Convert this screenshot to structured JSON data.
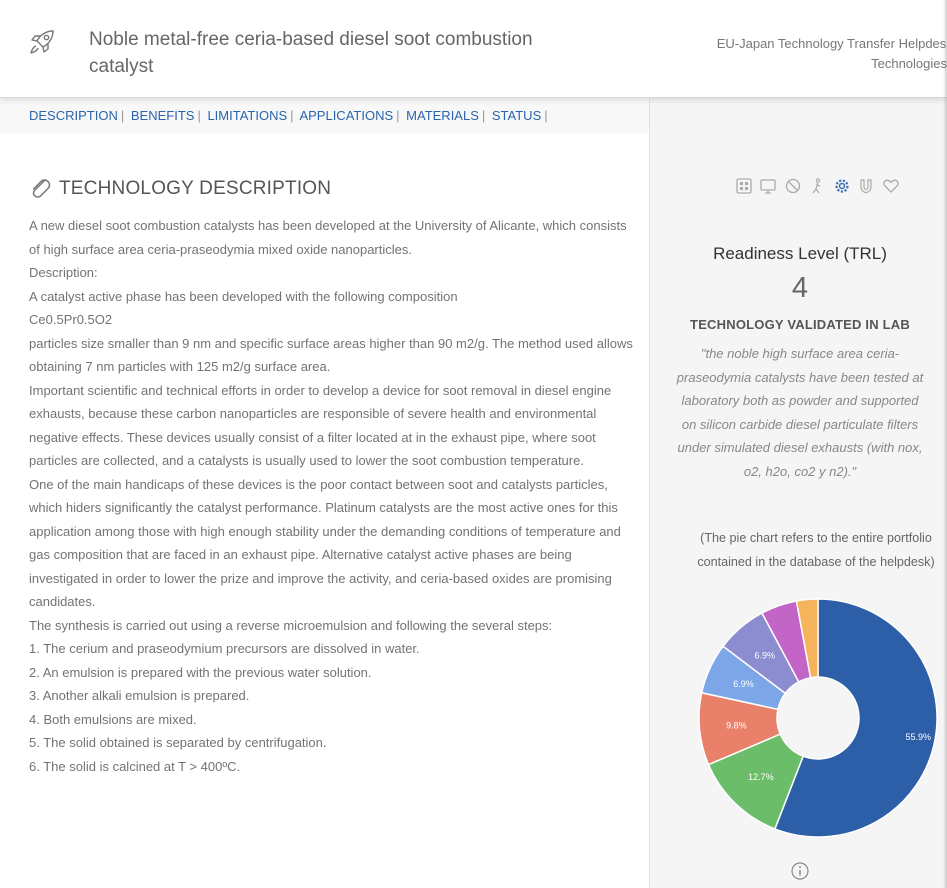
{
  "header": {
    "title": "Noble metal-free ceria-based diesel soot combustion catalyst",
    "org_line1": "EU-Japan Technology Transfer Helpdesk /",
    "org_line2": "Technologies"
  },
  "nav": {
    "items": [
      "DESCRIPTION",
      "BENEFITS",
      "LIMITATIONS",
      "APPLICATIONS",
      "MATERIALS",
      "STATUS"
    ]
  },
  "section": {
    "title": "TECHNOLOGY DESCRIPTION",
    "icon": "paperclip-icon"
  },
  "description": [
    "A new diesel soot combustion catalysts has been developed at the University of Alicante, which consists of high surface area ceria-praseodymia mixed oxide nanoparticles.",
    "Description:",
    "A catalyst active phase has been developed with the following composition",
    "Ce0.5Pr0.5O2",
    "particles size smaller than 9 nm and specific surface areas higher than 90 m2/g. The method used allows obtaining 7 nm particles with 125 m2/g surface area.",
    "Important scientific and technical efforts in order to develop a device for soot removal in diesel engine exhausts, because these carbon nanoparticles are responsible of severe health and environmental negative effects. These devices usually consist of a filter located at in the exhaust pipe, where soot particles are collected, and a catalysts is usually used to lower the soot combustion temperature.",
    "One of the main handicaps of these devices is the poor contact between soot and catalysts particles, which hiders significantly the catalyst performance. Platinum catalysts are the most active ones for this application among those with high enough stability under the demanding conditions of temperature and gas composition that are faced in an exhaust pipe. Alternative catalyst active phases are being investigated in order to lower the prize and improve the activity, and ceria-based oxides are promising candidates.",
    "The synthesis is carried out using a reverse microemulsion and following the several steps:",
    "1. The cerium and praseodymium precursors are dissolved in water.",
    "2. An emulsion is prepared with the previous water solution.",
    "3. Another alkali emulsion is prepared.",
    "4. Both emulsions are mixed.",
    "5. The solid obtained is separated by centrifugation.",
    "6. The solid is calcined at T > 400ºC."
  ],
  "sidebar": {
    "category_icons": [
      "grid-icon",
      "monitor-icon",
      "no-entry-icon",
      "person-icon",
      "gear-icon",
      "magnet-icon",
      "heart-icon"
    ],
    "active_icon": "gear-icon",
    "trl_title": "Readiness Level (TRL)",
    "trl_value": "4",
    "trl_status": "TECHNOLOGY VALIDATED IN LAB",
    "quote": "\"the noble high surface area ceria-praseodymia catalysts have been tested at laboratory both as powder and supported on silicon carbide diesel particulate filters under simulated diesel exhausts (with nox, o2, h2o, co2 y n2).\"",
    "pie_note_1": "(The pie chart refers to the entire portfolio",
    "pie_note_2": "contained in the database of the helpdesk)",
    "info_icon": "info-icon"
  },
  "chart_data": {
    "type": "pie",
    "donut": true,
    "slices": [
      {
        "value": 55.9,
        "label": "55.9%",
        "color": "#2c5fa8"
      },
      {
        "value": 12.7,
        "label": "12.7%",
        "color": "#6cbd6a"
      },
      {
        "value": 9.8,
        "label": "9.8%",
        "color": "#e8806a"
      },
      {
        "value": 6.9,
        "label": "6.9%",
        "color": "#7ca6e8"
      },
      {
        "value": 6.9,
        "label": "6.9%",
        "color": "#8c8cd0"
      },
      {
        "value": 4.9,
        "label": "",
        "color": "#c265c6"
      },
      {
        "value": 2.9,
        "label": "",
        "color": "#f5b35c"
      }
    ]
  }
}
